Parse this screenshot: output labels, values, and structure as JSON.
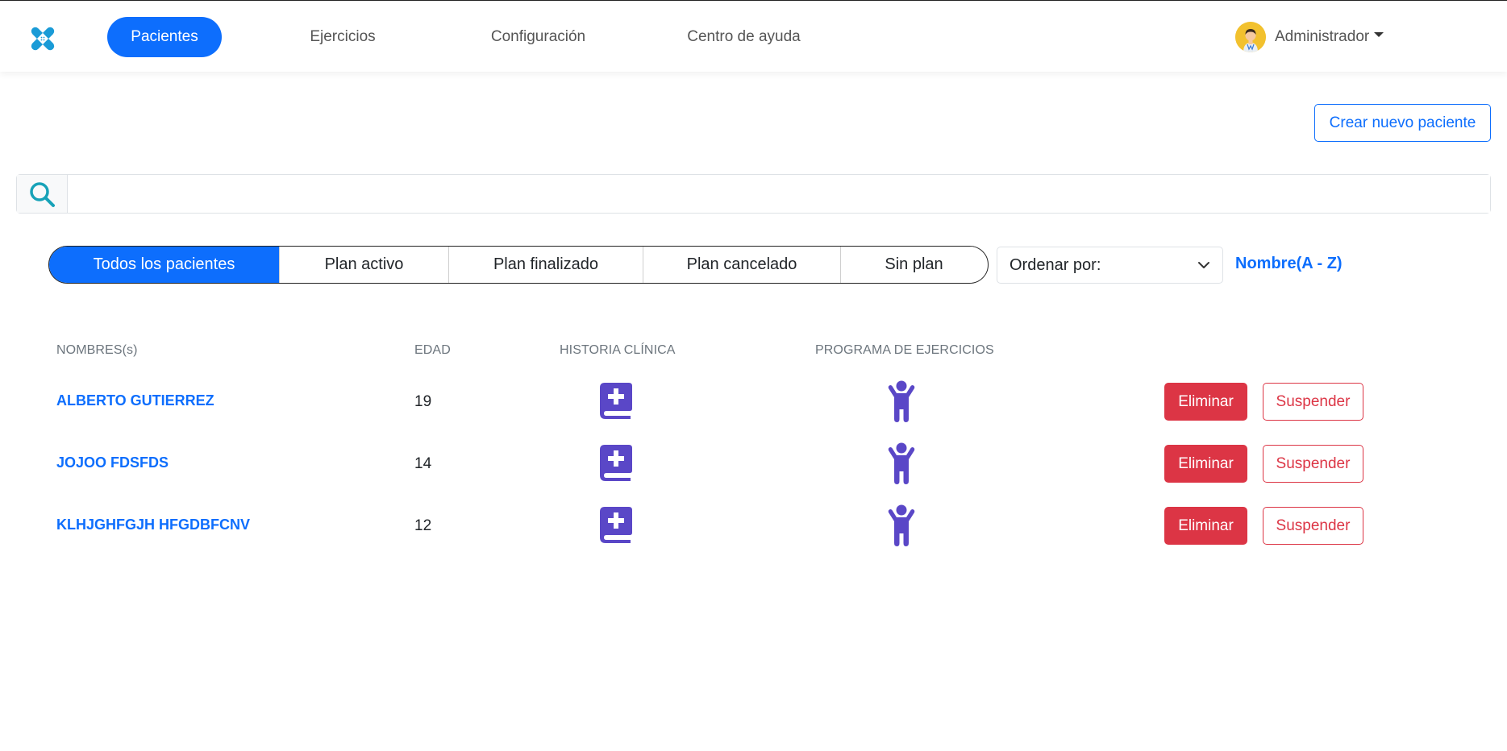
{
  "nav": {
    "logo_icon": "bandage-x-logo",
    "items": [
      {
        "label": "Pacientes",
        "active": true
      },
      {
        "label": "Ejercicios",
        "active": false
      },
      {
        "label": "Configuración",
        "active": false
      },
      {
        "label": "Centro de ayuda",
        "active": false
      }
    ],
    "user": {
      "name": "Administrador",
      "avatar_icon": "doctor-avatar-icon"
    }
  },
  "actions": {
    "create_patient_label": "Crear nuevo paciente"
  },
  "search": {
    "icon": "search-icon",
    "value": "",
    "placeholder": ""
  },
  "filters": [
    {
      "label": "Todos los pacientes",
      "active": true
    },
    {
      "label": "Plan activo",
      "active": false
    },
    {
      "label": "Plan finalizado",
      "active": false
    },
    {
      "label": "Plan cancelado",
      "active": false
    },
    {
      "label": "Sin plan",
      "active": false
    }
  ],
  "sort": {
    "label": "Ordenar por:",
    "value": "Nombre(A - Z)"
  },
  "table": {
    "headers": {
      "name": "NOMBRES(s)",
      "age": "EDAD",
      "history": "HISTORIA CLÍNICA",
      "program": "PROGRAMA DE EJERCICIOS"
    },
    "rows": [
      {
        "name": "ALBERTO GUTIERREZ",
        "age": "19",
        "delete_label": "Eliminar",
        "suspend_label": "Suspender"
      },
      {
        "name": "JOJOO FDSFDS",
        "age": "14",
        "delete_label": "Eliminar",
        "suspend_label": "Suspender"
      },
      {
        "name": "KLHJGHFGJH HFGDBFCNV",
        "age": "12",
        "delete_label": "Eliminar",
        "suspend_label": "Suspender"
      }
    ]
  },
  "colors": {
    "primary": "#0d6efd",
    "danger": "#dc3545",
    "icon_purple": "#5a47c7",
    "logo_blue": "#1a9bd7"
  }
}
